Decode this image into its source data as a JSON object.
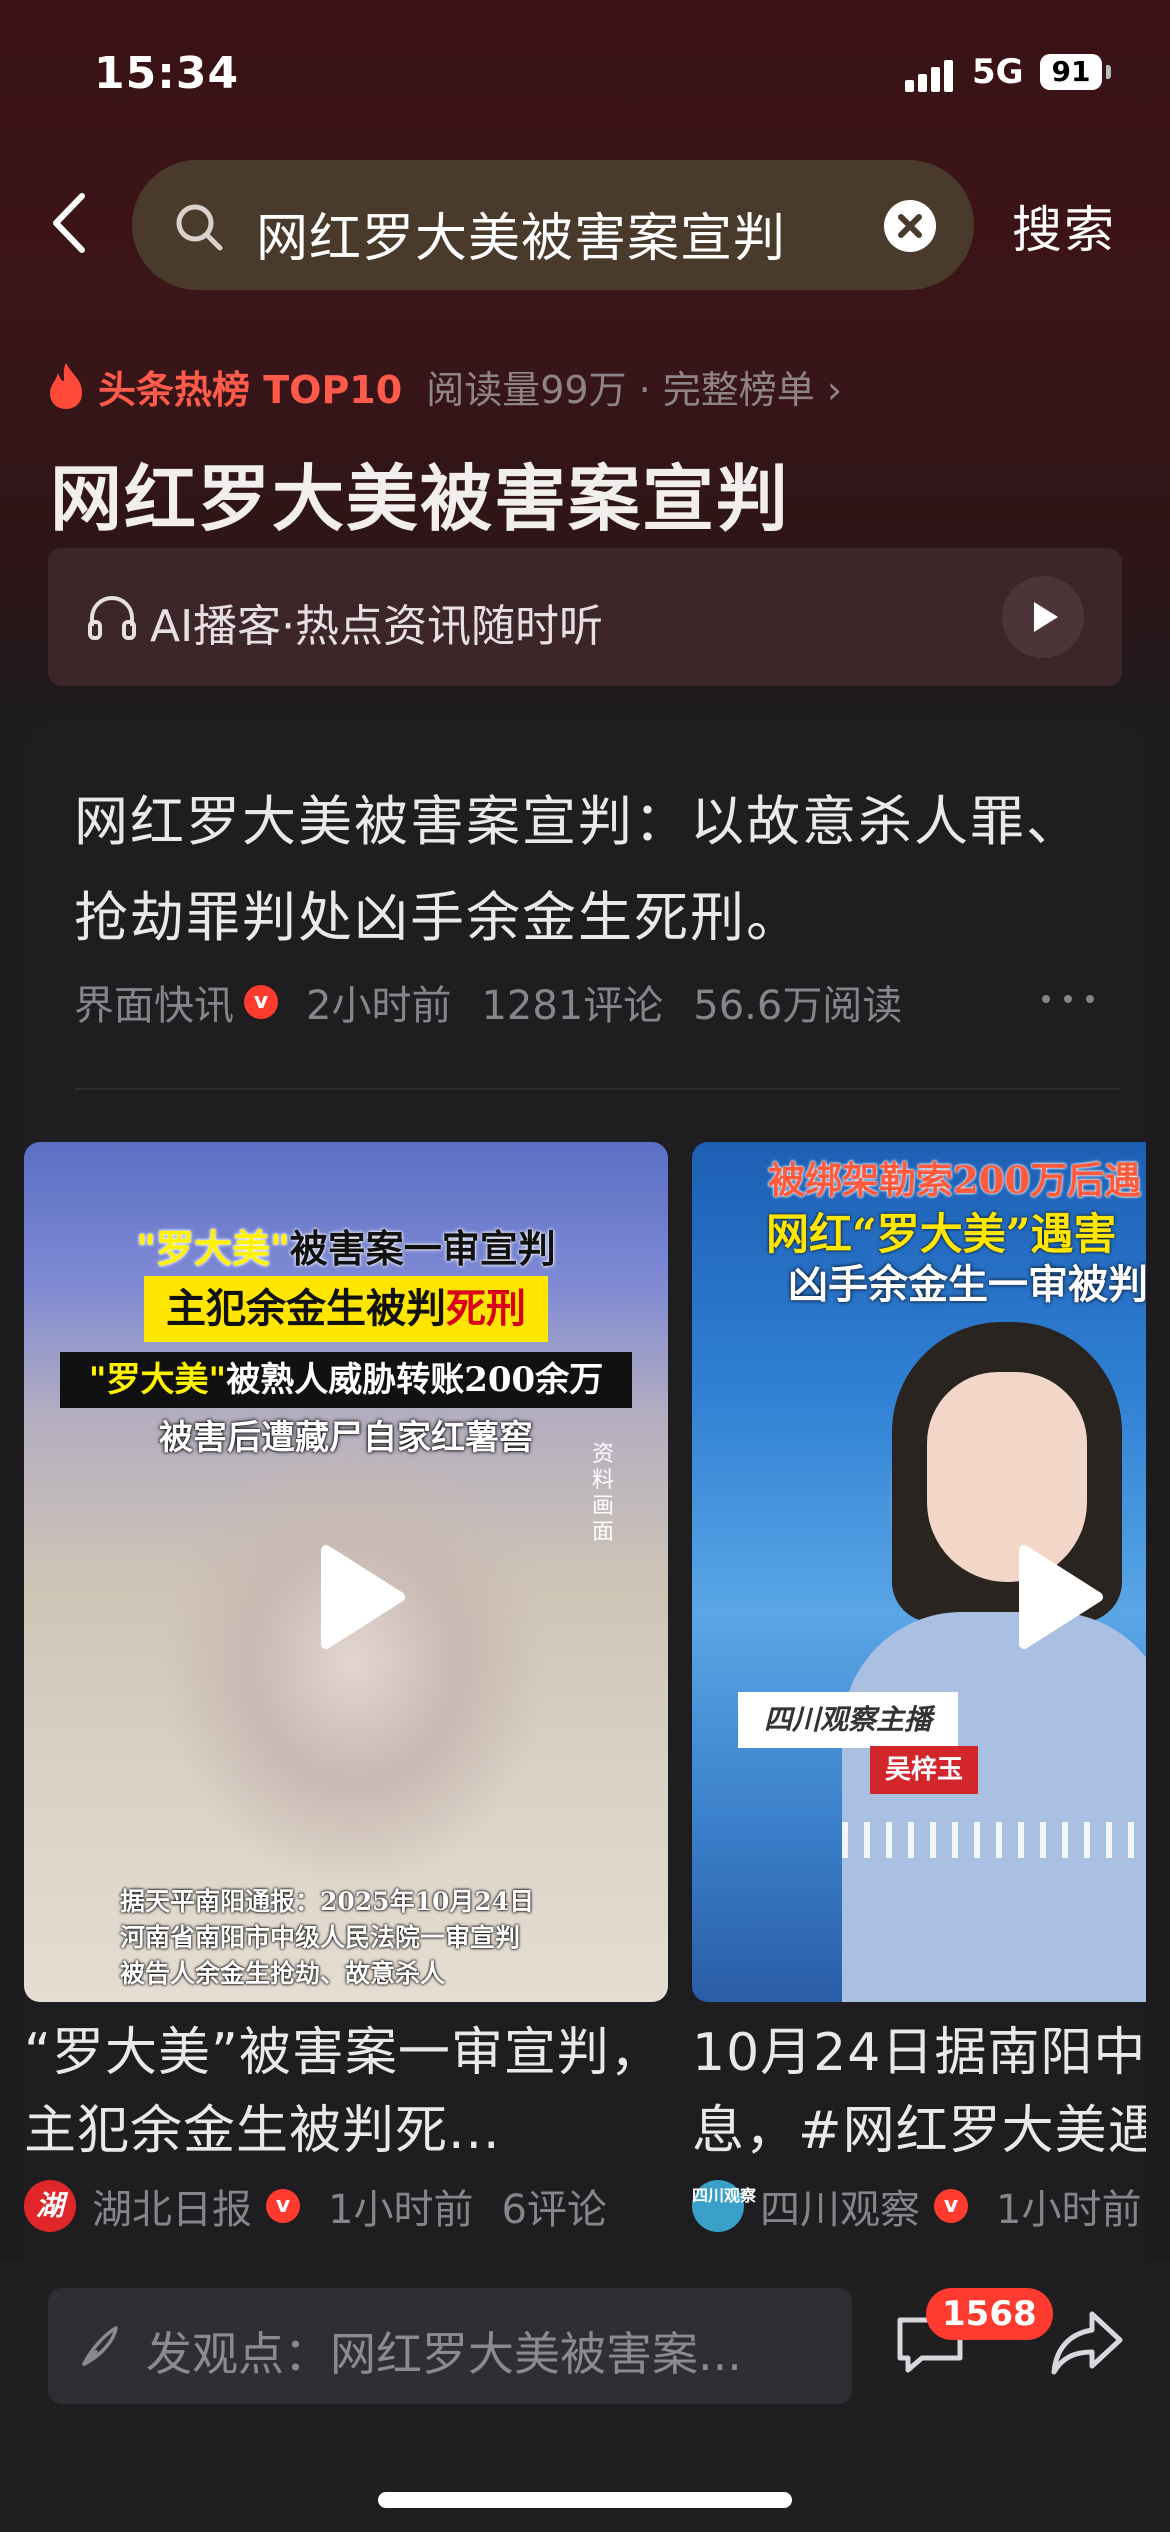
{
  "status_bar": {
    "time": "15:34",
    "network": "5G",
    "battery": "91"
  },
  "search": {
    "query": "网红罗大美被害案宣判",
    "submit_label": "搜索"
  },
  "hot": {
    "tag": "头条热榜 TOP10",
    "meta": "阅读量99万 · 完整榜单 ›",
    "title": "网红罗大美被害案宣判"
  },
  "podcast": {
    "label": "AI播客·热点资讯随时听"
  },
  "article": {
    "headline": "网红罗大美被害案宣判：以故意杀人罪、抢劫罪判处凶手余金生死刑。",
    "source": "界面快讯",
    "time": "2小时前",
    "comments": "1281评论",
    "reads": "56.6万阅读",
    "verified_mark": "v"
  },
  "videos": [
    {
      "cover_caption_1a": "\"罗大美\"",
      "cover_caption_1b": "被害案一审宣判",
      "cover_caption_2a": "主犯余金生被判",
      "cover_caption_2b": "死刑",
      "cover_caption_3a": "\"罗大美\"",
      "cover_caption_3b": "被熟人威胁转账200余万",
      "cover_caption_4": "被害后遭藏尸自家红薯窖",
      "side_note": "资料画面",
      "bottom_text": "据天平南阳通报：2025年10月24日\n河南省南阳市中级人民法院一审宣判\n被告人余金生抢劫、故意杀人",
      "title": "“罗大美”被害案一审宣判，主犯余金生被判死...",
      "source_logo": "湖",
      "source": "湖北日报",
      "time": "1小时前",
      "comments": "6评论"
    },
    {
      "cover_caption_1": "被绑架勒索200万后遇",
      "cover_caption_2": "网红“罗大美”遇害",
      "cover_caption_3": "凶手余金生一审被判",
      "badge_1": "四川观察主播",
      "badge_2": "吴梓玉",
      "title": "10月24日据南阳中息，#网红罗大美遇",
      "source_logo": "四川观察",
      "source": "四川观察",
      "time": "1小时前"
    }
  ],
  "comment_bar": {
    "placeholder": "发观点：网红罗大美被害案...",
    "comment_count": "1568"
  },
  "colors": {
    "hot_red": "#ff5a4a",
    "verified_red": "#ff3b2f",
    "badge_red": "#ff3b30"
  }
}
